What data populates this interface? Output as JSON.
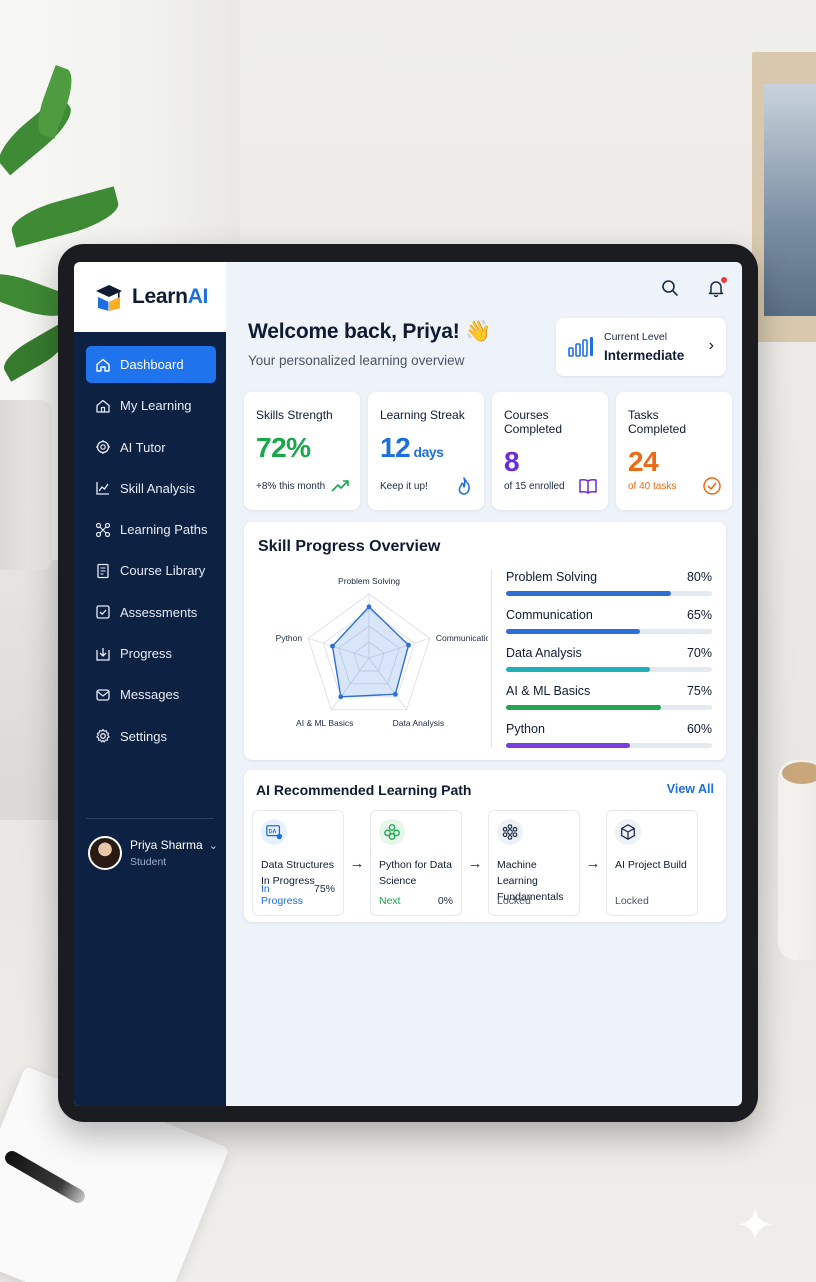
{
  "app": {
    "brand_prefix": "Learn",
    "brand_suffix": "AI"
  },
  "sidebar": {
    "items": [
      {
        "label": "Dashboard",
        "icon": "home-icon",
        "active": true
      },
      {
        "label": "My Learning",
        "icon": "home-outline-icon"
      },
      {
        "label": "AI Tutor",
        "icon": "ai-chip-icon"
      },
      {
        "label": "Skill Analysis",
        "icon": "chart-line-icon"
      },
      {
        "label": "Learning Paths",
        "icon": "path-nodes-icon"
      },
      {
        "label": "Course Library",
        "icon": "book-icon"
      },
      {
        "label": "Assessments",
        "icon": "checklist-icon"
      },
      {
        "label": "Progress",
        "icon": "progress-icon"
      },
      {
        "label": "Messages",
        "icon": "message-icon"
      },
      {
        "label": "Settings",
        "icon": "gear-icon"
      }
    ],
    "user": {
      "name": "Priya Sharma",
      "role": "Student"
    }
  },
  "header": {
    "welcome": "Welcome back, Priya! 👋",
    "subtitle": "Your personalized learning overview",
    "level_label": "Current Level",
    "level_value": "Intermediate"
  },
  "stats": [
    {
      "title": "Skills Strength",
      "value": "72%",
      "unit": "",
      "note": "+8% this month",
      "color": "#18a84c",
      "note_color": "#1e2a40",
      "icon": "trend-up-icon"
    },
    {
      "title": "Learning Streak",
      "value": "12",
      "unit": " days",
      "note": "Keep it up!",
      "color": "#1d6fe0",
      "note_color": "#1e2a40",
      "icon": "flame-icon"
    },
    {
      "title": "Courses Completed",
      "value": "8",
      "unit": "",
      "note": "of 15 enrolled",
      "color": "#6c2bd9",
      "note_color": "#1e2a40",
      "icon": "open-book-icon"
    },
    {
      "title": "Tasks Completed",
      "value": "24",
      "unit": "",
      "note": "of 40 tasks",
      "color": "#ea6a17",
      "note_color": "#ea6a17",
      "icon": "check-circle-icon"
    }
  ],
  "skill_progress": {
    "title": "Skill Progress Overview",
    "radar_labels": [
      "Problem Solving",
      "Communication",
      "Data Analysis",
      "AI & ML Basics",
      "Python"
    ],
    "skills": [
      {
        "name": "Problem Solving",
        "value": 80,
        "label": "80%",
        "color": "#2d6fd6"
      },
      {
        "name": "Communication",
        "value": 65,
        "label": "65%",
        "color": "#2d6fd6"
      },
      {
        "name": "Data Analysis",
        "value": 70,
        "label": "70%",
        "color": "#1fb0b5"
      },
      {
        "name": "AI & ML Basics",
        "value": 75,
        "label": "75%",
        "color": "#23a552"
      },
      {
        "name": "Python",
        "value": 60,
        "label": "60%",
        "color": "#7a3ee0"
      }
    ]
  },
  "learning_path": {
    "title": "AI Recommended Learning Path",
    "view_all": "View All",
    "steps": [
      {
        "name": "Data Structures In Progress",
        "status": "In Progress",
        "percent": "75%",
        "status_color": "#1d6fe0",
        "icon": "data-structures-icon",
        "icon_bg": "#e7f0ff"
      },
      {
        "name": "Python for Data Science",
        "status": "Next",
        "percent": "0%",
        "status_color": "#18a84c",
        "icon": "python-nodes-icon",
        "icon_bg": "#e6f6ea"
      },
      {
        "name": "Machine Learning Fundamentals",
        "status": "Locked",
        "percent": "",
        "status_color": "#4a5568",
        "icon": "ml-brain-icon",
        "icon_bg": "#eef1f6"
      },
      {
        "name": "AI Project Build",
        "status": "Locked",
        "percent": "",
        "status_color": "#4a5568",
        "icon": "cube-icon",
        "icon_bg": "#eef1f6"
      }
    ]
  }
}
